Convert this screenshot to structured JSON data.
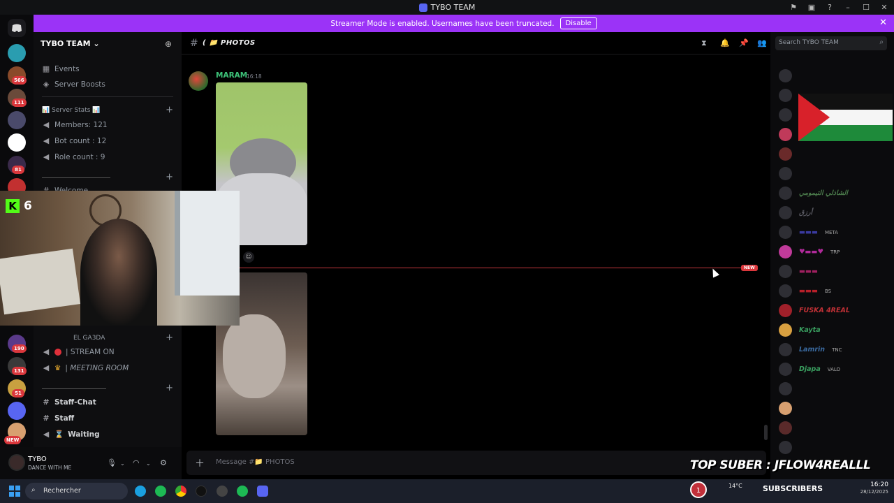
{
  "window": {
    "title": "TYBO TEAM"
  },
  "banner": {
    "text": "Streamer Mode is enabled. Usernames have been truncated.",
    "button": "Disable"
  },
  "rail": {
    "badges": [
      "566",
      "111",
      "81",
      "190",
      "131",
      "51"
    ],
    "new_label": "NEW"
  },
  "sidebar": {
    "guild_name": "TYBO TEAM",
    "events": "Events",
    "boosts": "Server Boosts",
    "stats_category": "📊 Server Stats 📊",
    "members": "Members: 121",
    "bots": "Bot count : 12",
    "roles": "Role count : 9",
    "welcome": "Welcome",
    "el_gazda": "EL GA3DA",
    "stream_on": "| STREAM ON",
    "meeting": "| MEETING ROOM",
    "staff_chat": "Staff-Chat",
    "staff": "Staff",
    "waiting": "Waiting"
  },
  "user": {
    "name": "TYBO",
    "status": "DANCE WITH ME"
  },
  "channel": {
    "name": "PHOTOS",
    "message_author": "MARAM",
    "message_time": "16:18",
    "new_label": "NEW",
    "composer_placeholder": "Message #📁 PHOTOS"
  },
  "members_panel": {
    "search_placeholder": "Search TYBO TEAM",
    "list": [
      {
        "name": "الشاذلي التيمومي",
        "color": "#4a7a4a",
        "tag": ""
      },
      {
        "name": "أرزق",
        "color": "#5a5a62",
        "tag": ""
      },
      {
        "name": "",
        "color": "#3a3aa0",
        "tag": "META"
      },
      {
        "name": "",
        "color": "#b02a9a",
        "tag": "TRP"
      },
      {
        "name": "",
        "color": "#a02060",
        "tag": ""
      },
      {
        "name": "",
        "color": "#b8202a",
        "tag": "BS"
      },
      {
        "name": "FUSKA 4REAL",
        "color": "#c03035",
        "tag": ""
      },
      {
        "name": "Kayta",
        "color": "#3aa060",
        "tag": ""
      },
      {
        "name": "Lamrin",
        "color": "#3a6aa0",
        "tag": "TNC"
      },
      {
        "name": "Djapa",
        "color": "#3aa060",
        "tag": "VALO"
      }
    ]
  },
  "webcam": {
    "kick_count": "6"
  },
  "overlay": {
    "top_suber": "TOP SUBER : JFLOW4REALLL",
    "subscribers": "SUBSCRIBERS",
    "notif_count": "1"
  },
  "taskbar": {
    "search_placeholder": "Rechercher",
    "temperature": "14°C",
    "time": "16:20",
    "date": "28/12/2025"
  },
  "colors": {
    "banner": "#9b33f7",
    "author": "#3ec47a",
    "badge": "#da373c",
    "kick": "#53fc18"
  }
}
